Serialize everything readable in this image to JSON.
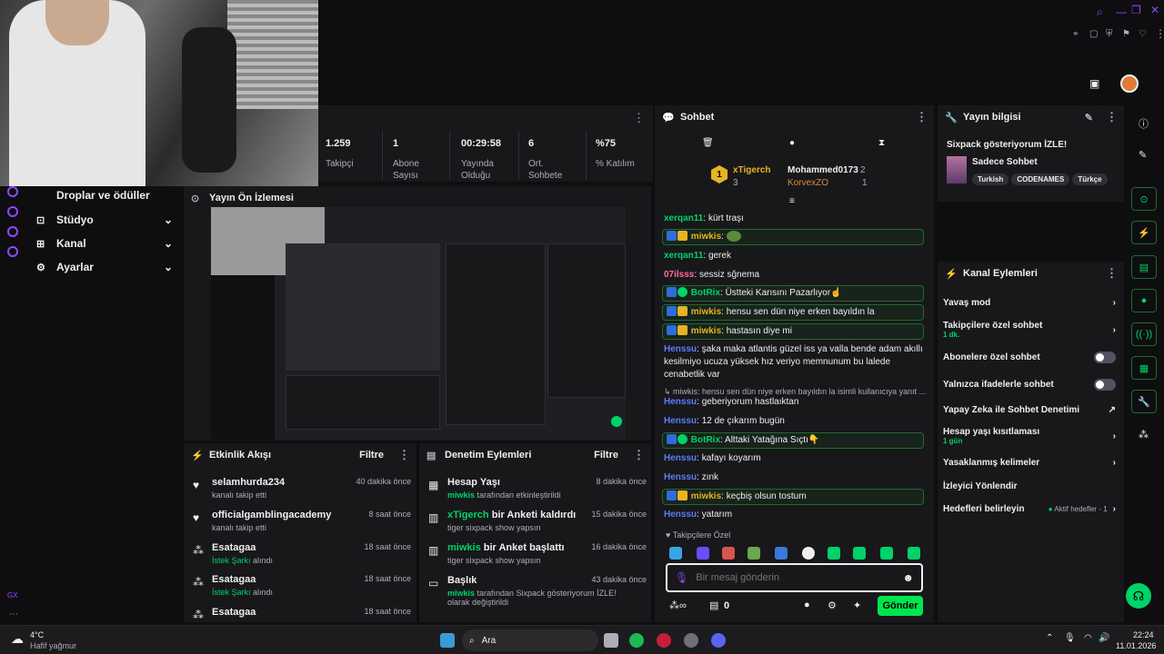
{
  "topbar": {
    "avatar_color": "#e07a3a"
  },
  "stats": [
    {
      "value": "1.259",
      "label": "Takipçi"
    },
    {
      "value": "1",
      "label": "Abone Sayısı"
    },
    {
      "value": "00:29:58",
      "label": "Yayında Olduğu"
    },
    {
      "value": "6",
      "label": "Ort. Sohbete"
    },
    {
      "value": "%75",
      "label": "% Katılım"
    }
  ],
  "nav": [
    {
      "label": "Droplar ve ödüller",
      "icon": "gift-icon"
    },
    {
      "label": "Stüdyo",
      "icon": "studio-icon"
    },
    {
      "label": "Kanal",
      "icon": "channel-icon"
    },
    {
      "label": "Ayarlar",
      "icon": "gear-icon"
    }
  ],
  "preview": {
    "title": "Yayın Ön İzlemesi"
  },
  "activity": {
    "title": "Etkinlik Akışı",
    "filter": "Filtre",
    "items": [
      {
        "name": "selamhurda234",
        "sub": "kanalı takip etti",
        "when": "40 dakika önce",
        "icon": "heart-icon"
      },
      {
        "name": "officialgamblingacademy",
        "sub": "kanalı takip etti",
        "when": "8 saat önce",
        "icon": "heart-icon"
      },
      {
        "name": "Esatagaa",
        "sub_green": "İstek Şarkı",
        "sub": " alındı",
        "when": "18 saat önce",
        "icon": "points-icon"
      },
      {
        "name": "Esatagaa",
        "sub_green": "İstek Şarkı",
        "sub": " alındı",
        "when": "18 saat önce",
        "icon": "points-icon"
      },
      {
        "name": "Esatagaa",
        "sub": "",
        "when": "18 saat önce",
        "icon": "points-icon"
      }
    ]
  },
  "moderation": {
    "title": "Denetim Eylemleri",
    "filter": "Filtre",
    "items": [
      {
        "name": "Hesap Yaşı",
        "by": "miwkis",
        "sub": " tarafından etkinleştirildi",
        "when": "8 dakika önce",
        "icon": "calendar-icon"
      },
      {
        "name_green": "xTigerch",
        "name": " bir Anketi kaldırdı",
        "sub": "tiger sixpack show yapsın",
        "when": "15 dakika önce",
        "icon": "poll-icon"
      },
      {
        "name_green": "miwkis",
        "name": " bir Anket başlattı",
        "sub": "tiger sixpack show yapsın",
        "when": "16 dakika önce",
        "icon": "poll-icon"
      },
      {
        "name": "Başlık",
        "by": "miwkis",
        "sub": " tarafından Sixpack gösteriyorum İZLE! olarak değiştirildi",
        "when": "43 dakika önce",
        "icon": "title-icon"
      }
    ]
  },
  "chat": {
    "title": "Sohbet",
    "leaderboard": {
      "first": {
        "rank": "1",
        "name": "xTigerch",
        "count": "3"
      },
      "second": {
        "name": "Mohammed0173",
        "count": "2"
      },
      "third": {
        "name": "KorvexZO",
        "count": "1"
      }
    },
    "messages": [
      {
        "user": "xerqan11",
        "text": "kürt traşı",
        "color": "#00d26a",
        "box": false
      },
      {
        "user": "miwkis",
        "text": "",
        "color": "#e6b422",
        "box": true,
        "emote": true
      },
      {
        "user": "xerqan11",
        "text": "gerek",
        "color": "#00d26a",
        "box": false
      },
      {
        "user": "07ilsss",
        "text": "sessiz sğnema",
        "color": "#ff6b9d",
        "box": false
      },
      {
        "user": "BotRix",
        "text": "Üstteki Karısını Pazarlıyor☝",
        "color": "#00d26a",
        "box": true
      },
      {
        "user": "miwkis",
        "text": "hensu sen dün niye erken bayıldın la",
        "color": "#e6b422",
        "box": true
      },
      {
        "user": "miwkis",
        "text": "hastasın diye mi",
        "color": "#e6b422",
        "box": true
      },
      {
        "user": "Henssu",
        "text": "şaka maka atlantis güzel iss ya valla bende adam akıllı kesilmiyo ucuza yüksek hız veriyo memnunum bu lalede cenabetlik var",
        "color": "#5b7cfa",
        "box": false
      },
      {
        "user": "",
        "text": "↳ miwkis: hensu sen dün niye erken bayıldın la isimli kullanıcıya yanıt ...",
        "color": "#adadb8",
        "box": false
      },
      {
        "user": "Henssu",
        "text": "geberiyorum hastlaıktan",
        "color": "#5b7cfa",
        "box": false
      },
      {
        "user": "Henssu",
        "text": "12 de çıkarım bugün",
        "color": "#5b7cfa",
        "box": false
      },
      {
        "user": "BotRix",
        "text": "Alttaki Yatağına Sıçtı👇",
        "color": "#00d26a",
        "box": true
      },
      {
        "user": "Henssu",
        "text": "kafayı koyarım",
        "color": "#5b7cfa",
        "box": false
      },
      {
        "user": "Henssu",
        "text": "zınk",
        "color": "#5b7cfa",
        "box": false
      },
      {
        "user": "miwkis",
        "text": "keçbiş olsun tostum",
        "color": "#e6b422",
        "box": true
      },
      {
        "user": "Henssu",
        "text": "yatarım",
        "color": "#5b7cfa",
        "box": false
      }
    ],
    "followers_only": "Takipçilere Özel",
    "input_placeholder": "Bir mesaj gönderin",
    "points": "0",
    "send": "Gönder"
  },
  "stream_info": {
    "title": "Yayın bilgisi",
    "stream_title": "Sixpack gösteriyorum İZLE!",
    "category": "Sadece Sohbet",
    "tags": [
      "Turkish",
      "CODENAMES",
      "Türkçe"
    ]
  },
  "channel_actions": {
    "title": "Kanal Eylemleri",
    "items": [
      {
        "label": "Yavaş mod",
        "sub": "",
        "right": "chevron"
      },
      {
        "label": "Takipçilere özel sohbet",
        "sub": "1 dk.",
        "right": "chevron"
      },
      {
        "label": "Abonelere özel sohbet",
        "sub": "",
        "right": "toggle"
      },
      {
        "label": "Yalnızca ifadelerle sohbet",
        "sub": "",
        "right": "toggle"
      },
      {
        "label": "Yapay Zeka ile Sohbet Denetimi",
        "sub": "",
        "right": "external"
      },
      {
        "label": "Hesap yaşı kısıtlaması",
        "sub": "1 gün",
        "right": "chevron"
      },
      {
        "label": "Yasaklanmış kelimeler",
        "sub": "",
        "right": "chevron"
      },
      {
        "label": "İzleyici Yönlendir",
        "sub": "",
        "right": ""
      },
      {
        "label": "Hedefleri belirleyin",
        "sub": "",
        "right": "chevron",
        "note": "Aktif hedefler - 1"
      }
    ]
  },
  "taskbar": {
    "weather_temp": "4°C",
    "weather_desc": "Hafif yağmur",
    "search": "Ara",
    "time": "22:24",
    "date": "11.01.2026"
  }
}
